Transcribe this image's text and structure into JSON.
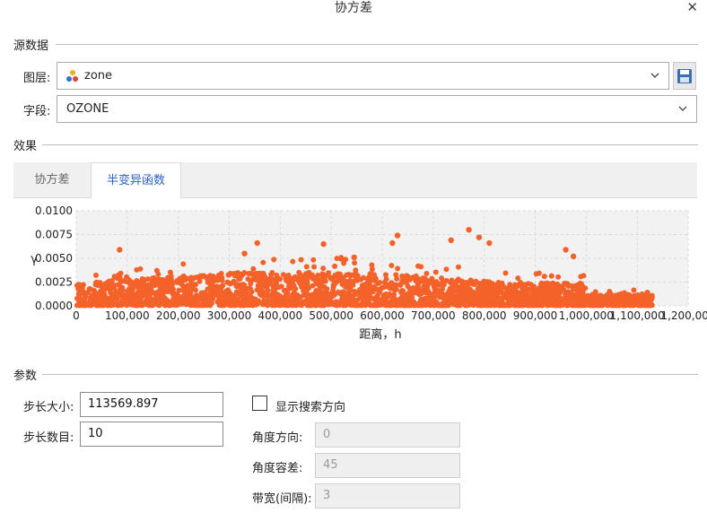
{
  "window": {
    "title": "协方差",
    "close_glyph": "✕"
  },
  "source": {
    "section_label": "源数据",
    "layer_label": "图层:",
    "layer_value": "zone",
    "field_label": "字段:",
    "field_value": "OZONE"
  },
  "effect": {
    "section_label": "效果",
    "tabs": [
      {
        "label": "协方差",
        "active": false
      },
      {
        "label": "半变异函数",
        "active": true
      }
    ]
  },
  "chart_data": {
    "type": "scatter",
    "series": [
      {
        "color": "#f4622a"
      }
    ],
    "xlabel": "距离，h",
    "ylabel": "γ",
    "xlim": [
      0,
      1200000
    ],
    "ylim": [
      0,
      0.01
    ],
    "x_ticks": [
      "0",
      "100,000",
      "200,000",
      "300,000",
      "400,000",
      "500,000",
      "600,000",
      "700,000",
      "800,000",
      "900,000",
      "1,000,000",
      "1,100,000",
      "1,200,000"
    ],
    "y_ticks": [
      "0.0000",
      "0.0025",
      "0.0050",
      "0.0075",
      "0.0100"
    ],
    "grid": true,
    "notable_points": [
      {
        "x": 85000,
        "y": 0.0059
      },
      {
        "x": 330000,
        "y": 0.0055
      },
      {
        "x": 355000,
        "y": 0.0066
      },
      {
        "x": 485000,
        "y": 0.0065
      },
      {
        "x": 545000,
        "y": 0.0051
      },
      {
        "x": 620000,
        "y": 0.0066
      },
      {
        "x": 630000,
        "y": 0.0074
      },
      {
        "x": 735000,
        "y": 0.0069
      },
      {
        "x": 770000,
        "y": 0.008
      },
      {
        "x": 790000,
        "y": 0.0072
      },
      {
        "x": 810000,
        "y": 0.0066
      },
      {
        "x": 960000,
        "y": 0.0059
      },
      {
        "x": 975000,
        "y": 0.0052
      },
      {
        "x": 1045000,
        "y": 0.0011
      },
      {
        "x": 1120000,
        "y": 0.0014
      }
    ]
  },
  "params": {
    "section_label": "参数",
    "lag_size_label": "步长大小:",
    "lag_size_value": "113569.897",
    "lag_count_label": "步长数目:",
    "lag_count_value": "10",
    "show_direction_label": "显示搜索方向",
    "show_direction_checked": false,
    "angle_label": "角度方向:",
    "angle_value": "0",
    "tolerance_label": "角度容差:",
    "tolerance_value": "45",
    "bandwidth_label": "带宽(间隔):",
    "bandwidth_value": "3"
  },
  "colors": {
    "accent_tab": "#2a62c9",
    "point": "#f4622a",
    "save_icon": "#3a6db3"
  }
}
